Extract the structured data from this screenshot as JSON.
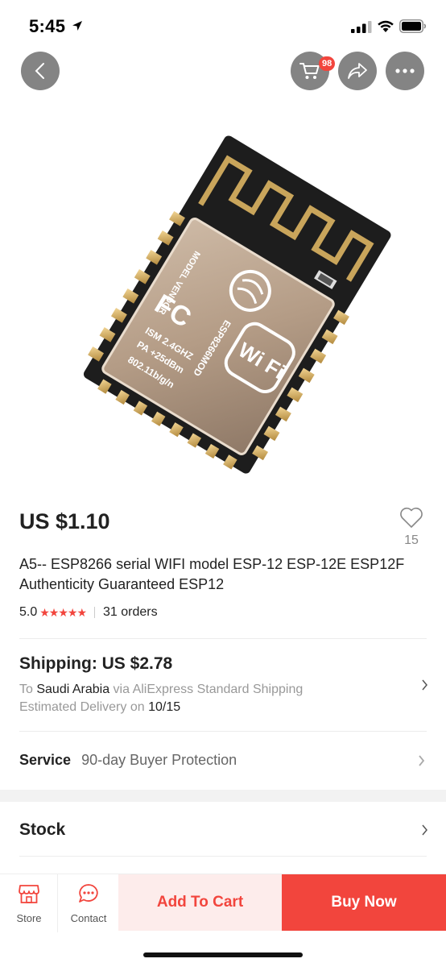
{
  "status_bar": {
    "time": "5:45"
  },
  "header": {
    "cart_badge": "98"
  },
  "product": {
    "price": "US $1.10",
    "wishlist_count": "15",
    "title": "A5-- ESP8266 serial WIFI model ESP-12 ESP-12E ESP12F Authenticity Guaranteed ESP12",
    "rating": "5.0",
    "stars": "★★★★★",
    "orders": "31 orders"
  },
  "shipping": {
    "title": "Shipping: US $2.78",
    "to_prefix": "To",
    "country": "Saudi Arabia",
    "via": "via AliExpress Standard Shipping",
    "delivery_prefix": "Estimated Delivery on",
    "delivery_date": "10/15"
  },
  "service": {
    "label": "Service",
    "value": "90-day Buyer Protection"
  },
  "stock": {
    "label": "Stock"
  },
  "bottom_bar": {
    "store_label": "Store",
    "contact_label": "Contact",
    "add_to_cart": "Add To Cart",
    "buy_now": "Buy Now"
  },
  "image_text": {
    "vendor": "MODEL VENDOR",
    "fcc": "FC",
    "model": "ESP8266MOD",
    "ism": "ISM 2.4GHZ",
    "pa": "PA +25dBm",
    "standard": "802.11b/g/n",
    "wifi": "Wi Fi"
  },
  "colors": {
    "accent": "#f2453d",
    "add_to_cart_bg": "#fdeceb",
    "text_primary": "#222222",
    "text_muted": "#999999"
  },
  "icons": {
    "back": "chevron-left-icon",
    "cart": "cart-icon",
    "share": "share-icon",
    "more": "more-icon",
    "wishlist": "heart-icon",
    "store": "store-icon",
    "contact": "chat-icon"
  }
}
